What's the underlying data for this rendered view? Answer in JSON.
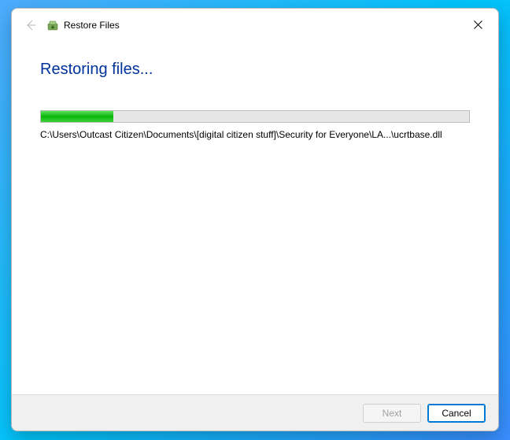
{
  "window": {
    "title": "Restore Files"
  },
  "content": {
    "heading": "Restoring files...",
    "progress_percent": 17,
    "current_path": "C:\\Users\\Outcast Citizen\\Documents\\[digital citizen stuff]\\Security for Everyone\\LA...\\ucrtbase.dll"
  },
  "footer": {
    "next_label": "Next",
    "cancel_label": "Cancel"
  }
}
